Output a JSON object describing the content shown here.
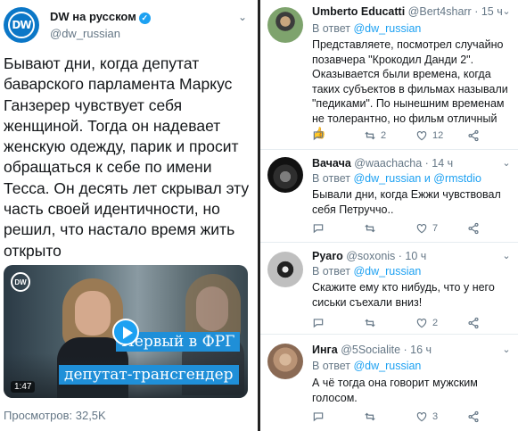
{
  "left": {
    "account_name": "DW на русском",
    "account_handle": "@dw_russian",
    "tweet_text": "Бывают дни, когда депутат баварского парламента Маркус Ганзерер чувствует себя женщиной. Тогда он надевает женскую одежду, парик и просит обращаться к себе по имени Тесса. Он десять лет скрывал эту часть своей идентичности, но решил, что настало время жить открыто",
    "video": {
      "logo_text": "DW",
      "caption_line1": "Первый в ФРГ",
      "caption_line2": "депутат-трансгендер",
      "duration": "1:47"
    },
    "views": "Просмотров: 32,5K"
  },
  "replies": [
    {
      "name": "Umberto Educatti",
      "handle": "@Bert4sharr · 15 ч",
      "in_reply_prefix": "В ответ ",
      "in_reply_mention": "@dw_russian",
      "text": "Представляете, посмотрел случайно позавчера \"Крокодил Данди 2\". Оказывается были времена, когда таких субъектов в фильмах называли \"педиками\". По нынешним временам не толерантно, но фильм отличный 👍",
      "replies_count": "",
      "retweets": "2",
      "likes": "12"
    },
    {
      "name": "Вачача",
      "handle": "@waachacha · 14 ч",
      "in_reply_prefix": "В ответ ",
      "in_reply_mention": "@dw_russian и @rmstdio",
      "text": "Бывали дни, когда Ежжи чувствовал себя Петруччо..",
      "replies_count": "",
      "retweets": "",
      "likes": "7"
    },
    {
      "name": "Pyaro",
      "handle": "@soxonis · 10 ч",
      "in_reply_prefix": "В ответ ",
      "in_reply_mention": "@dw_russian",
      "text": "Скажите ему кто нибудь, что у него сиськи съехали вниз!",
      "replies_count": "",
      "retweets": "",
      "likes": "2"
    },
    {
      "name": "Инга",
      "handle": "@5Socialite · 16 ч",
      "in_reply_prefix": "В ответ ",
      "in_reply_mention": "@dw_russian",
      "text": "А чё тогда она говорит мужским голосом.",
      "replies_count": "",
      "retweets": "",
      "likes": "3"
    }
  ],
  "colors": {
    "accent": "#1da1f2",
    "muted": "#657786",
    "text": "#14171a",
    "dw_blue": "#0b77c7"
  }
}
